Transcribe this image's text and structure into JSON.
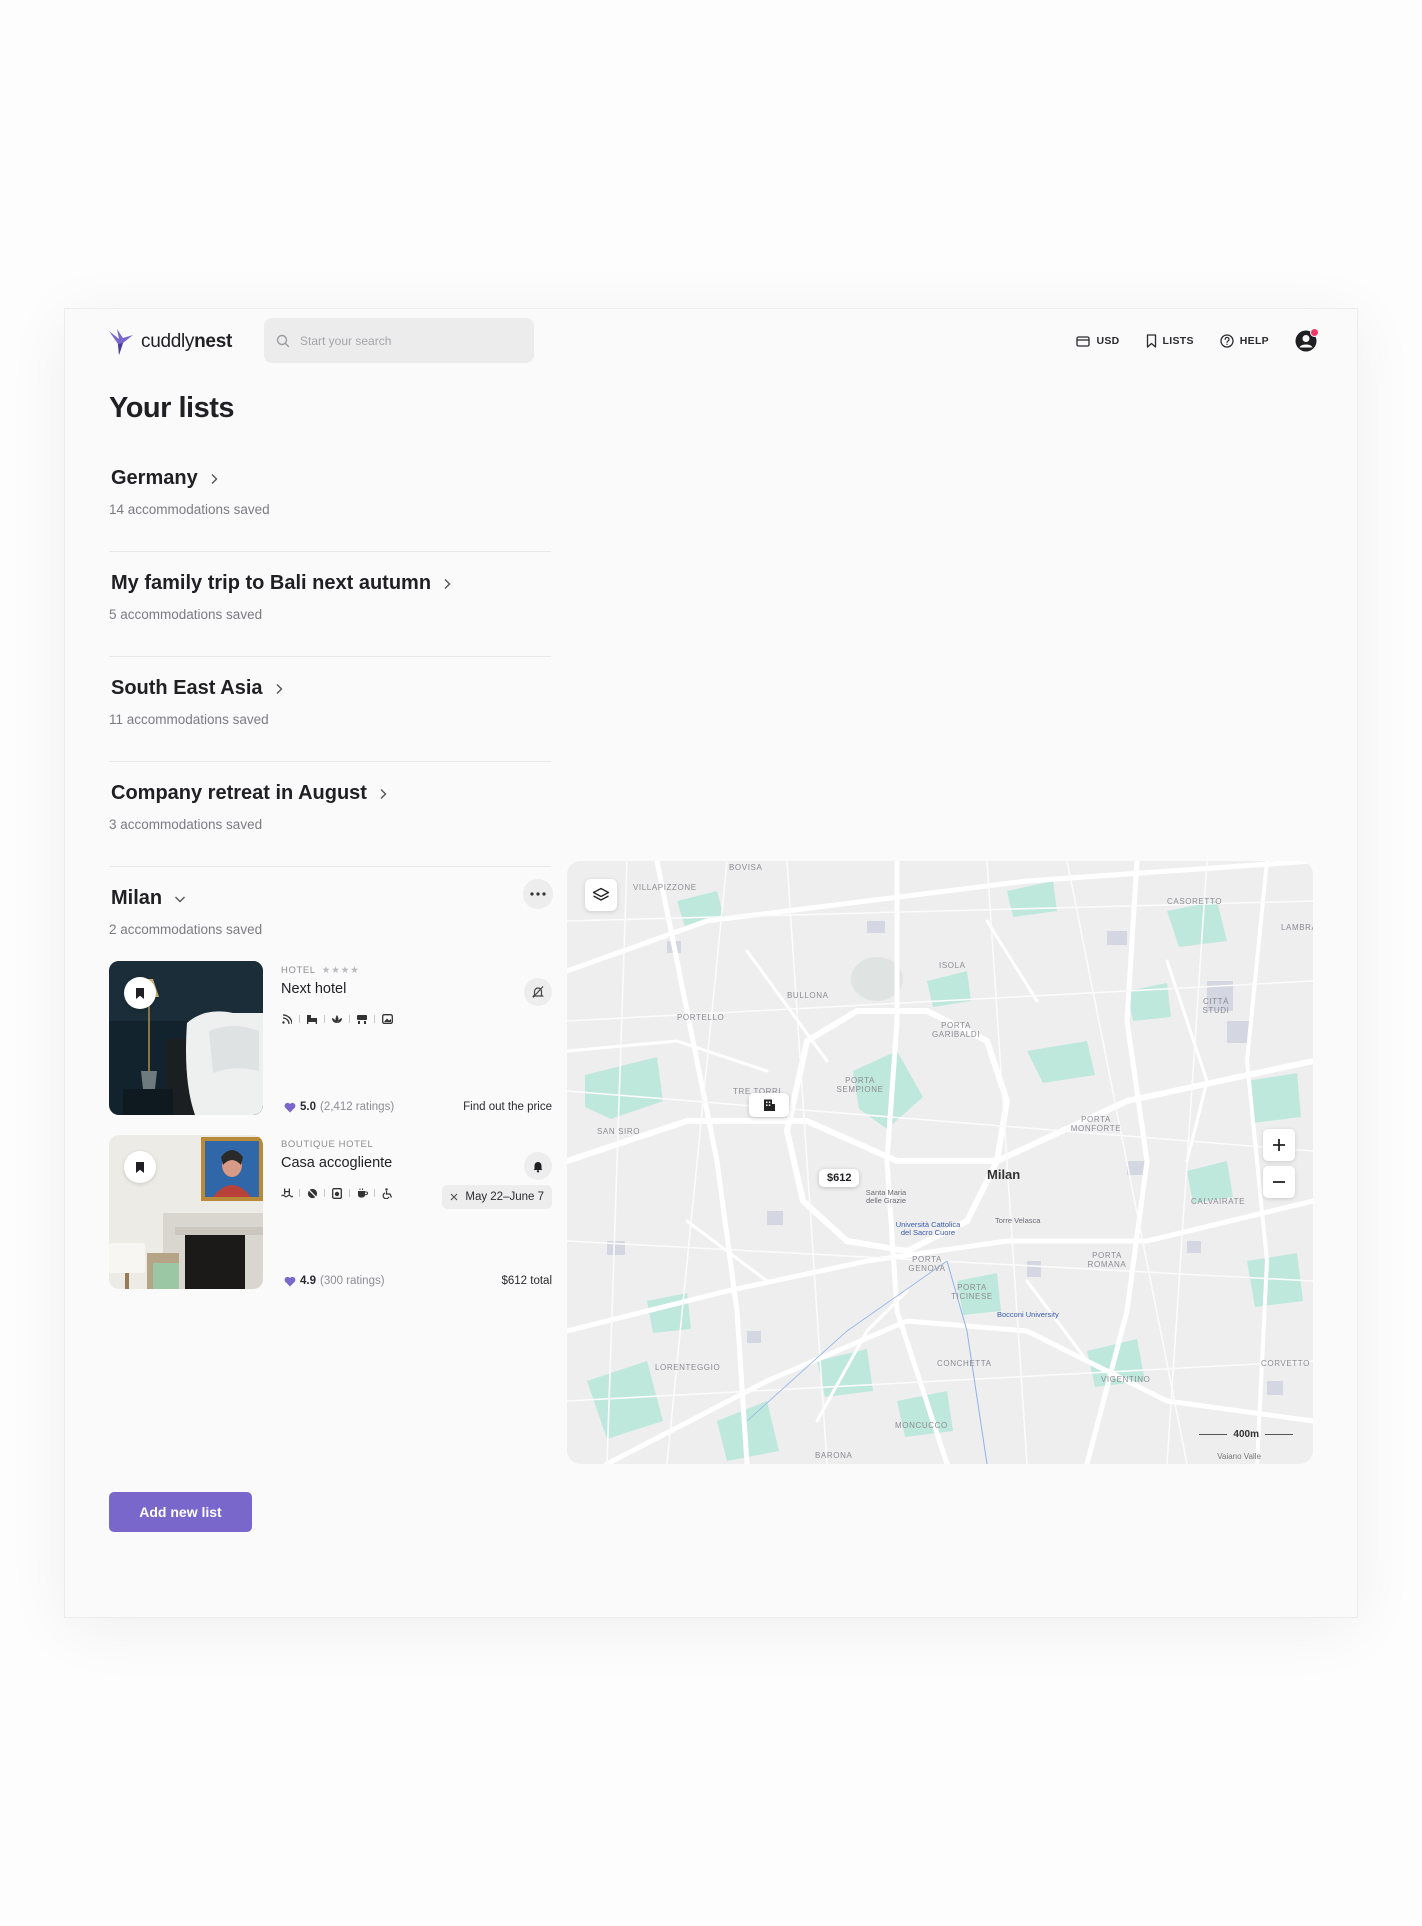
{
  "header": {
    "logo_text_light": "cuddly",
    "logo_text_bold": "nest",
    "search_placeholder": "Start your search",
    "nav": {
      "currency": "USD",
      "lists": "LISTS",
      "help": "HELP"
    }
  },
  "page_title": "Your lists",
  "lists": [
    {
      "title": "Germany",
      "count": "14 accommodations saved"
    },
    {
      "title": "My family trip to Bali next autumn",
      "count": "5 accommodations saved"
    },
    {
      "title": "South East Asia",
      "count": "11 accommodations saved"
    },
    {
      "title": "Company retreat in August",
      "count": "3 accommodations saved"
    },
    {
      "title": "Milan",
      "count": "2 accommodations saved"
    }
  ],
  "cards": [
    {
      "type": "HOTEL",
      "stars": "★★★★",
      "name": "Next hotel",
      "rating": "5.0",
      "ratings_count": "(2,412 ratings)",
      "right_text": "Find out the price"
    },
    {
      "type": "BOUTIQUE HOTEL",
      "name": "Casa accogliente",
      "dates": "May 22–June 7",
      "rating": "4.9",
      "ratings_count": "(300 ratings)",
      "right_text": "$612 total"
    }
  ],
  "add_button": "Add new list",
  "map": {
    "city": "Milan",
    "price_pin": "$612",
    "scale": "400m",
    "attribution": "Vaiano Valle",
    "districts": {
      "bovisa": "BOVISA",
      "villapizzone": "VILLAPIZZONE",
      "casoretto": "CASORETTO",
      "lambrate": "LAMBRAT",
      "isola": "ISOLA",
      "bullona": "BULLONA",
      "portello": "PORTELLO",
      "garibaldi": "PORTA GARIBALDI",
      "citta_studi": "CITTÀ STUDI",
      "tre_torri": "TRE TORRI",
      "sempione": "PORTA SEMPIONE",
      "monforte": "PORTA MONFORTE",
      "san_siro": "SAN SIRO",
      "calvairate": "CALVAIRATE",
      "porta_genova": "PORTA GENOVA",
      "porta_romana": "PORTA ROMANA",
      "porta_ticinese": "PORTA TICINESE",
      "lorenteggio": "LORENTEGGIO",
      "conchetta": "CONCHETTA",
      "vigentino": "VIGENTINO",
      "corvetto": "CORVETTO",
      "moncucco": "MONCUCCO",
      "barona": "BARONA"
    },
    "pois": {
      "santa_maria": "Santa Maria delle Grazie",
      "cattolica": "Università Cattolica del Sacro Cuore",
      "velasca": "Torre Velasca",
      "bocconi": "Bocconi University"
    }
  },
  "colors": {
    "accent": "#7a67cc",
    "notification": "#f0386b",
    "map_green": "#bfe8dc",
    "map_bg": "#eeeeef"
  }
}
